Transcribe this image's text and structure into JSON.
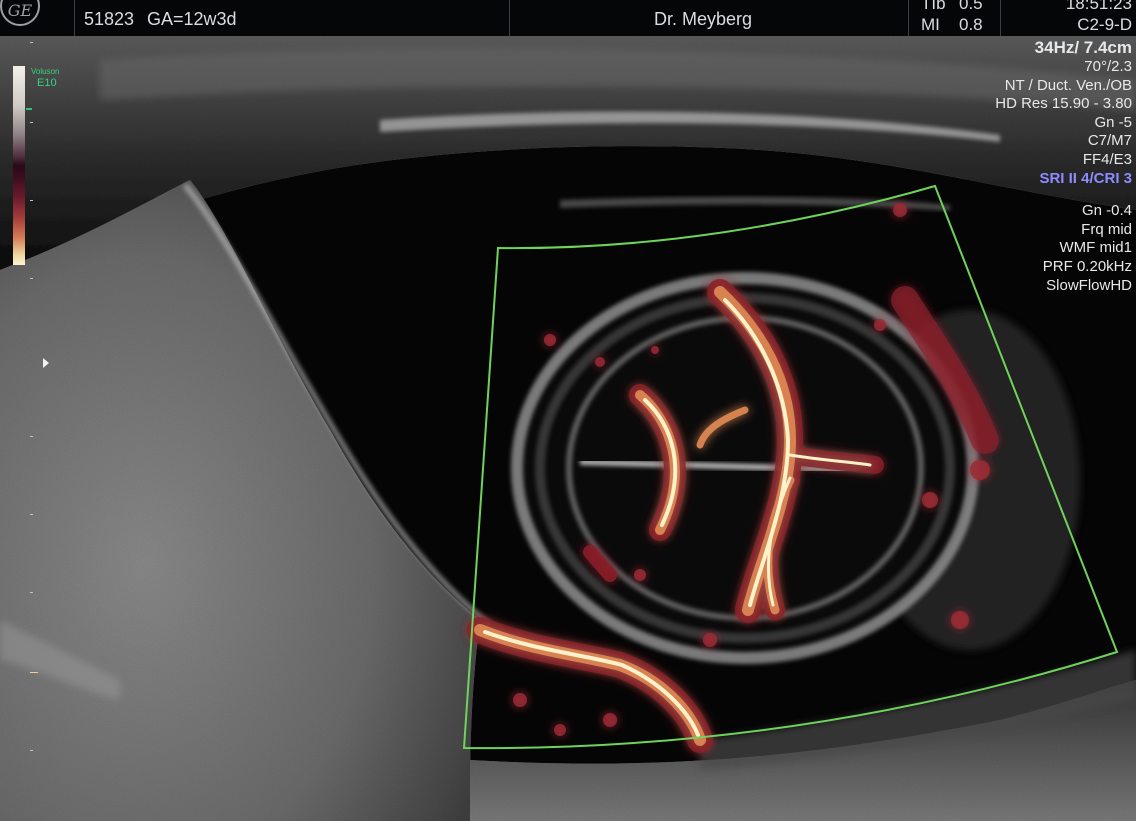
{
  "header": {
    "patient_id": "51823",
    "gestational_age": "GA=12w3d",
    "operator": "Dr. Meyberg",
    "tib_label": "TIb",
    "tib_value": "0.5",
    "mi_label": "MI",
    "mi_value": "0.8",
    "time": "18:51:23",
    "probe": "C2-9-D",
    "logo_text": "GE"
  },
  "device": {
    "brand_line1": "Voluson",
    "brand_line2": "E10",
    "accent_color": "#35d27a"
  },
  "params": {
    "frame_depth": "34Hz/ 7.4cm",
    "angle": "70°/2.3",
    "preset": "NT / Duct. Ven./OB",
    "hd_res": "HD Res 15.90 - 3.80",
    "gain": "Gn  -5",
    "c_m": "C7/M7",
    "ff_e": "FF4/E3",
    "sri_cri": "SRI II 4/CRI 3",
    "color_gain": "Gn -0.4",
    "frequency": "Frq mid",
    "wmf": "WMF mid1",
    "prf": "PRF 0.20kHz",
    "mode": "SlowFlowHD",
    "sri_color": "#8c8cff",
    "roi_color": "#6fd35b"
  }
}
